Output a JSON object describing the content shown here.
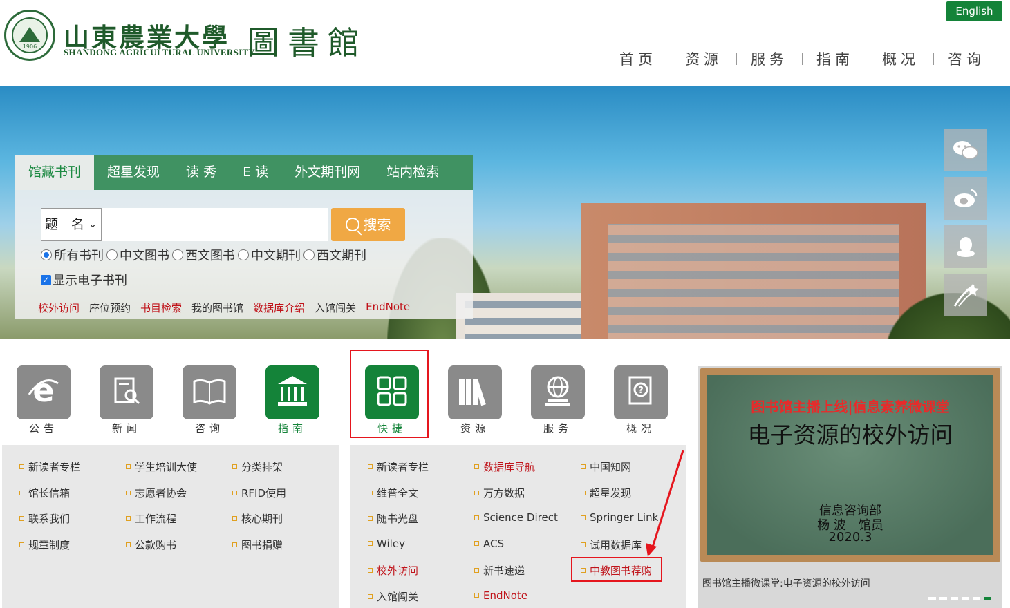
{
  "header": {
    "logo_cn": "山東農業大學",
    "logo_en": "SHANDONG AGRICULTURAL UNIVERSITY",
    "logo_lib": "圖書館",
    "seal_year": "1906",
    "english_label": "English",
    "nav": [
      "首页",
      "资源",
      "服务",
      "指南",
      "概况",
      "咨询"
    ]
  },
  "search": {
    "tabs": [
      "馆藏书刊",
      "超星发现",
      "读 秀",
      "E 读",
      "外文期刊网",
      "站内检索"
    ],
    "active_tab": 0,
    "select_value": "题　名",
    "input_value": "",
    "button_label": "搜索",
    "radios": [
      "所有书刊",
      "中文图书",
      "西文图书",
      "中文期刊",
      "西文期刊"
    ],
    "radio_selected": 0,
    "checkbox_label": "显示电子书刊",
    "checkbox_checked": true,
    "quick_links": [
      {
        "label": "校外访问",
        "style": "red"
      },
      {
        "label": "座位预约",
        "style": "dark"
      },
      {
        "label": "书目检索",
        "style": "red"
      },
      {
        "label": "我的图书馆",
        "style": "dark"
      },
      {
        "label": "数据库介绍",
        "style": "red"
      },
      {
        "label": "入馆闯关",
        "style": "dark"
      },
      {
        "label": "EndNote",
        "style": "red"
      }
    ]
  },
  "social": [
    "wechat-icon",
    "weibo-icon",
    "qq-icon",
    "meteor-icon"
  ],
  "icons": [
    {
      "label": "公告",
      "icon": "ie-icon",
      "active": false
    },
    {
      "label": "新闻",
      "icon": "news-icon",
      "active": false
    },
    {
      "label": "咨询",
      "icon": "book-icon",
      "active": false
    },
    {
      "label": "指南",
      "icon": "institution-icon",
      "active": true
    },
    {
      "label": "快捷",
      "icon": "grid-icon",
      "active": true
    },
    {
      "label": "资源",
      "icon": "books-icon",
      "active": false
    },
    {
      "label": "服务",
      "icon": "globe-icon",
      "active": false
    },
    {
      "label": "概况",
      "icon": "question-book-icon",
      "active": false
    }
  ],
  "guide_panel": [
    [
      "新读者专栏",
      "学生培训大使",
      "分类排架"
    ],
    [
      "馆长信箱",
      "志愿者协会",
      "RFID使用"
    ],
    [
      "联系我们",
      "工作流程",
      "核心期刊"
    ],
    [
      "规章制度",
      "公款购书",
      "图书捐赠"
    ]
  ],
  "quick_panel": [
    [
      {
        "t": "新读者专栏",
        "r": false
      },
      {
        "t": "数据库导航",
        "r": true
      },
      {
        "t": "中国知网",
        "r": false
      }
    ],
    [
      {
        "t": "维普全文",
        "r": false
      },
      {
        "t": "万方数据",
        "r": false
      },
      {
        "t": "超星发现",
        "r": false
      }
    ],
    [
      {
        "t": "随书光盘",
        "r": false
      },
      {
        "t": "Science Direct",
        "r": false
      },
      {
        "t": "Springer Link",
        "r": false
      }
    ],
    [
      {
        "t": "Wiley",
        "r": false
      },
      {
        "t": "ACS",
        "r": false
      },
      {
        "t": "试用数据库",
        "r": false
      }
    ],
    [
      {
        "t": "校外访问",
        "r": true
      },
      {
        "t": "新书速递",
        "r": false
      },
      {
        "t": "中教图书荐购",
        "r": true
      }
    ],
    [
      {
        "t": "入馆闯关",
        "r": false
      },
      {
        "t": "EndNote",
        "r": true
      },
      null
    ]
  ],
  "slide": {
    "title": "图书馆主播上线|信息素养微课堂",
    "main": "电子资源的校外访问",
    "line1": "信息咨询部",
    "line2": "杨 波　馆员",
    "line3": "2020.3",
    "caption": "图书馆主播微课堂:电子资源的校外访问",
    "dots": 6,
    "active_dot": 5
  },
  "colors": {
    "brand": "#148339",
    "accent_orange": "#f0a844",
    "link_red": "#c0131a",
    "highlight": "#e5161e"
  }
}
